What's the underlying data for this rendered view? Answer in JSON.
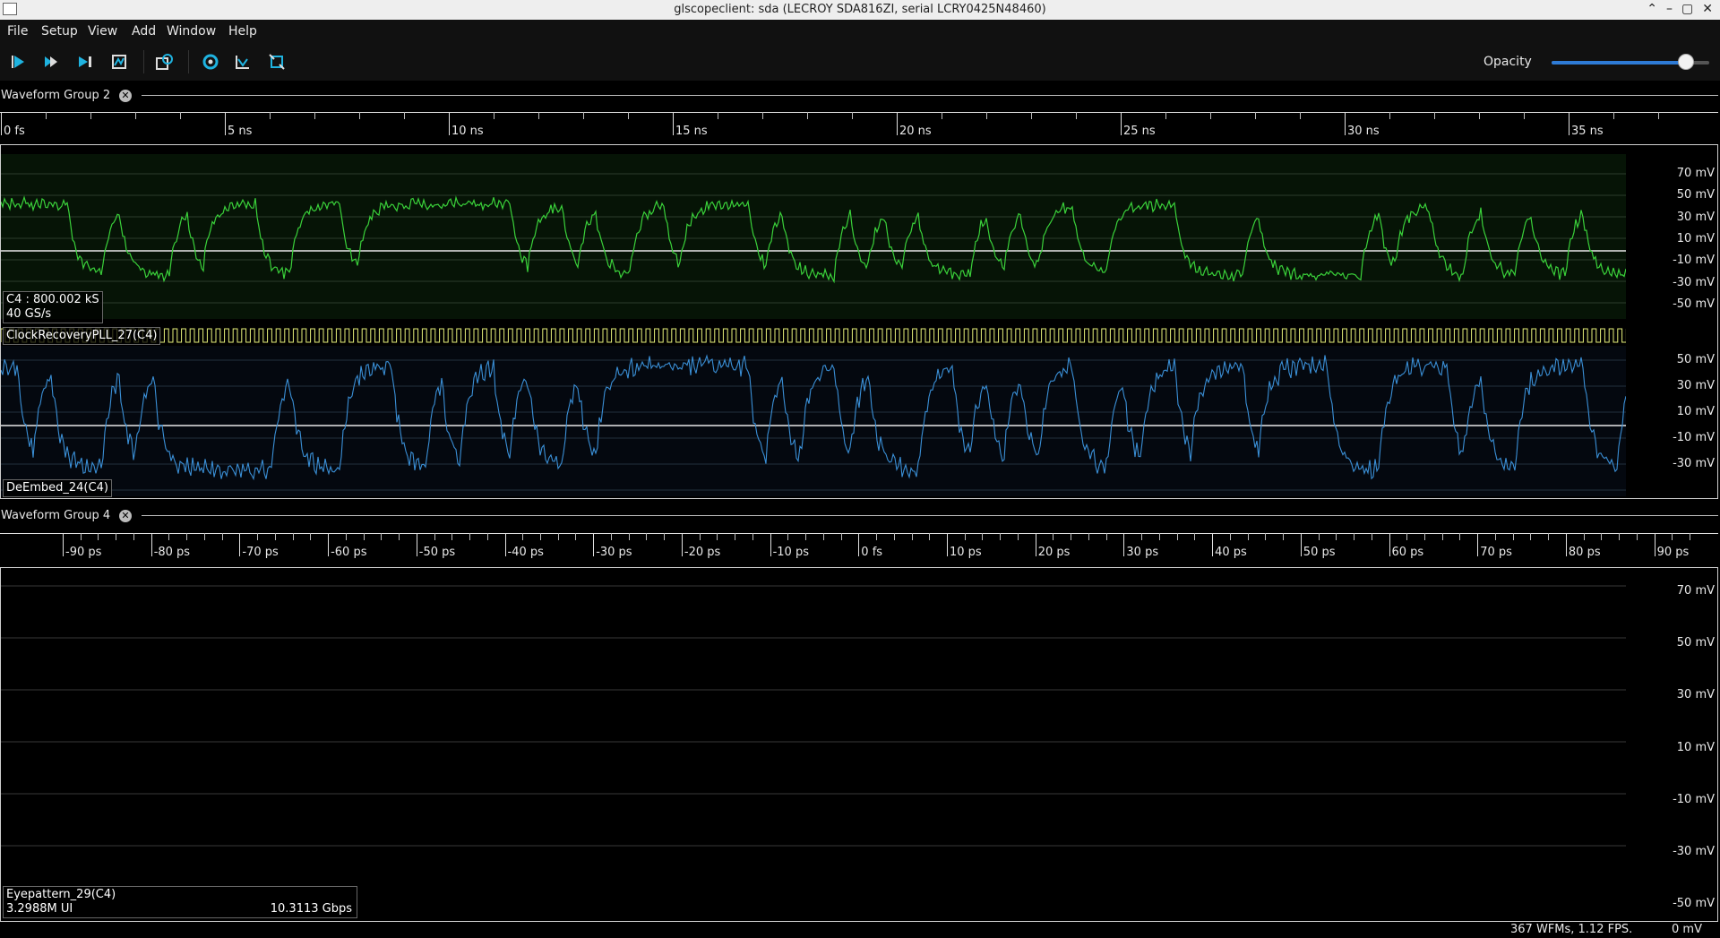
{
  "window": {
    "title": "glscopeclient: sda (LECROY SDA816ZI, serial LCRY0425N48460)"
  },
  "menu": [
    "File",
    "Setup",
    "View",
    "Add",
    "Window",
    "Help"
  ],
  "toolbar": {
    "opacity_label": "Opacity",
    "opacity_value": 0.85
  },
  "group2": {
    "title": "Waveform Group 2",
    "time_ticks": [
      "0 fs",
      "5 ns",
      "10 ns",
      "15 ns",
      "20 ns",
      "25 ns",
      "30 ns",
      "35 ns"
    ],
    "c4": {
      "label_line1": "C4 : 800.002 kS",
      "label_line2": "40 GS/s",
      "color": "#3ad13a",
      "vticks": [
        "70 mV",
        "50 mV",
        "30 mV",
        "10 mV",
        "-10 mV",
        "-30 mV",
        "-50 mV"
      ]
    },
    "clock": {
      "label": "ClockRecoveryPLL_27(C4)",
      "color": "#e6f07a"
    },
    "deembed": {
      "label": "DeEmbed_24(C4)",
      "color": "#3a8fd6",
      "vticks": [
        "50 mV",
        "30 mV",
        "10 mV",
        "-10 mV",
        "-30 mV"
      ]
    }
  },
  "group4": {
    "title": "Waveform Group 4",
    "time_ticks": [
      "-90 ps",
      "-80 ps",
      "-70 ps",
      "-60 ps",
      "-50 ps",
      "-40 ps",
      "-30 ps",
      "-20 ps",
      "-10 ps",
      "0 fs",
      "10 ps",
      "20 ps",
      "30 ps",
      "40 ps",
      "50 ps",
      "60 ps",
      "70 ps",
      "80 ps",
      "90 ps"
    ],
    "eye": {
      "label_line1": "Eyepattern_29(C4)",
      "label_line2": "3.2988M UI",
      "rate": "10.3113 Gbps",
      "vticks": [
        "70 mV",
        "50 mV",
        "30 mV",
        "10 mV",
        "-10 mV",
        "-30 mV",
        "-50 mV"
      ]
    }
  },
  "status": {
    "wfms": "367 WFMs, 1.12 FPS.",
    "cursor": "0 mV"
  }
}
